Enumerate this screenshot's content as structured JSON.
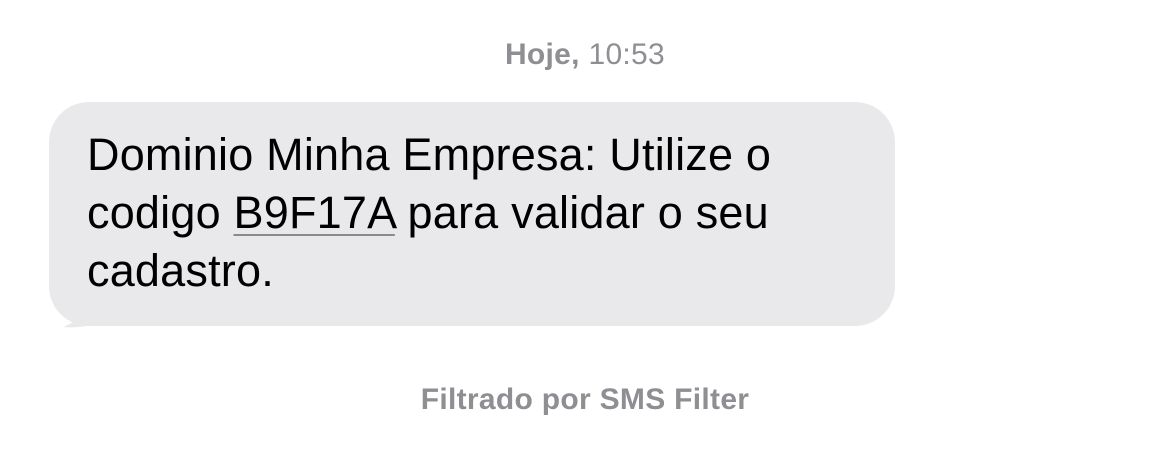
{
  "timestamp": {
    "day": "Hoje,",
    "time": "10:53"
  },
  "message": {
    "part1": "Dominio Minha Empresa: Utilize o codigo ",
    "code": "B9F17A",
    "part2": " para validar o seu cadastro."
  },
  "filter_note": "Filtrado por SMS Filter",
  "colors": {
    "bubble_bg": "#e9e9eb",
    "meta_text": "#8e8e93",
    "message_text": "#000000"
  }
}
